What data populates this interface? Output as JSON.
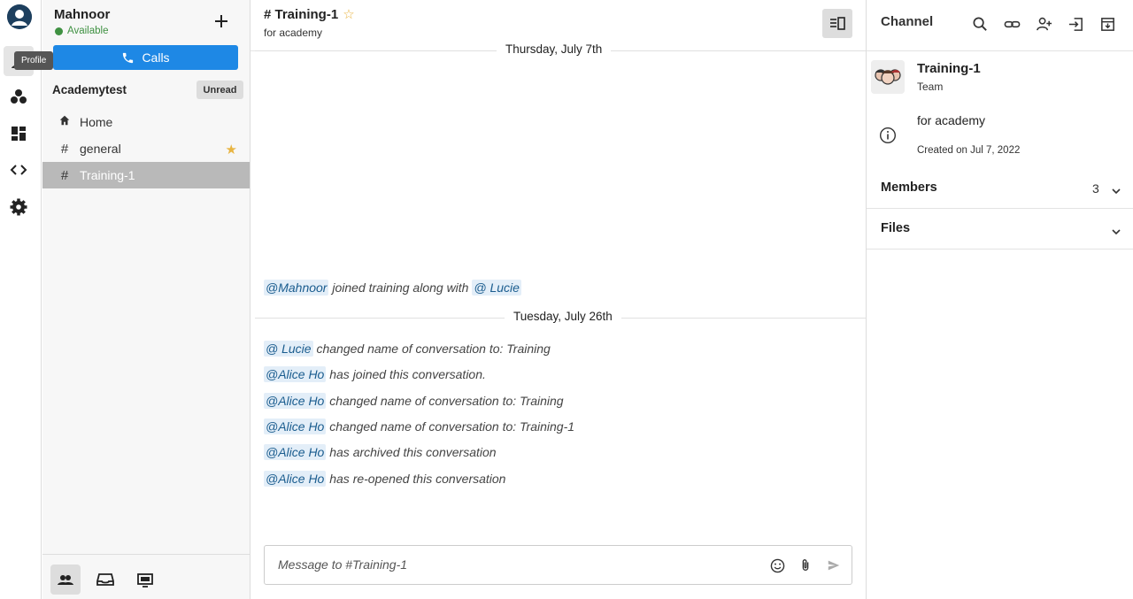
{
  "rail": {
    "tooltip": "Profile",
    "items": [
      "profile-icon",
      "team-icon",
      "dashboard-icon",
      "code-icon",
      "settings-icon"
    ]
  },
  "sidebar": {
    "user_name": "Mahnoor",
    "status": "Available",
    "calls_label": "Calls",
    "team_name": "Academytest",
    "unread_label": "Unread",
    "items": [
      {
        "icon": "home-icon",
        "label": "Home"
      },
      {
        "icon": "hash-icon",
        "label": "general",
        "favorite": true
      },
      {
        "icon": "hash-icon",
        "label": "Training-1",
        "active": true
      }
    ],
    "bottom": [
      "team-icon",
      "inbox-icon",
      "screen-icon"
    ]
  },
  "channel": {
    "title": "# Training-1",
    "topic": "for academy",
    "date1": "Thursday, July 7th",
    "date2": "Tuesday, July 26th",
    "messages": [
      {
        "mention": "@Mahnoor",
        "text": " joined training along with ",
        "mention2": "@ Lucie"
      },
      {
        "mention": "@ Lucie",
        "text": " changed name of conversation to: Training"
      },
      {
        "mention": "@Alice Ho",
        "text": " has joined this conversation."
      },
      {
        "mention": "@Alice Ho",
        "text": " changed name of conversation to: Training"
      },
      {
        "mention": "@Alice Ho",
        "text": " changed name of conversation to: Training-1"
      },
      {
        "mention": "@Alice Ho",
        "text": " has archived this conversation"
      },
      {
        "mention": "@Alice Ho",
        "text": " has re-opened this conversation"
      }
    ],
    "composer_placeholder": "Message to #Training-1"
  },
  "panel": {
    "title": "Channel",
    "team_name": "Training-1",
    "team_type": "Team",
    "topic": "for academy",
    "created": "Created on Jul 7, 2022",
    "members_label": "Members",
    "members_count": "3",
    "files_label": "Files"
  },
  "colors": {
    "accent": "#1e88e5",
    "available": "#3f9142",
    "favorite": "#e8b441",
    "mention_bg": "#e3eef8"
  }
}
